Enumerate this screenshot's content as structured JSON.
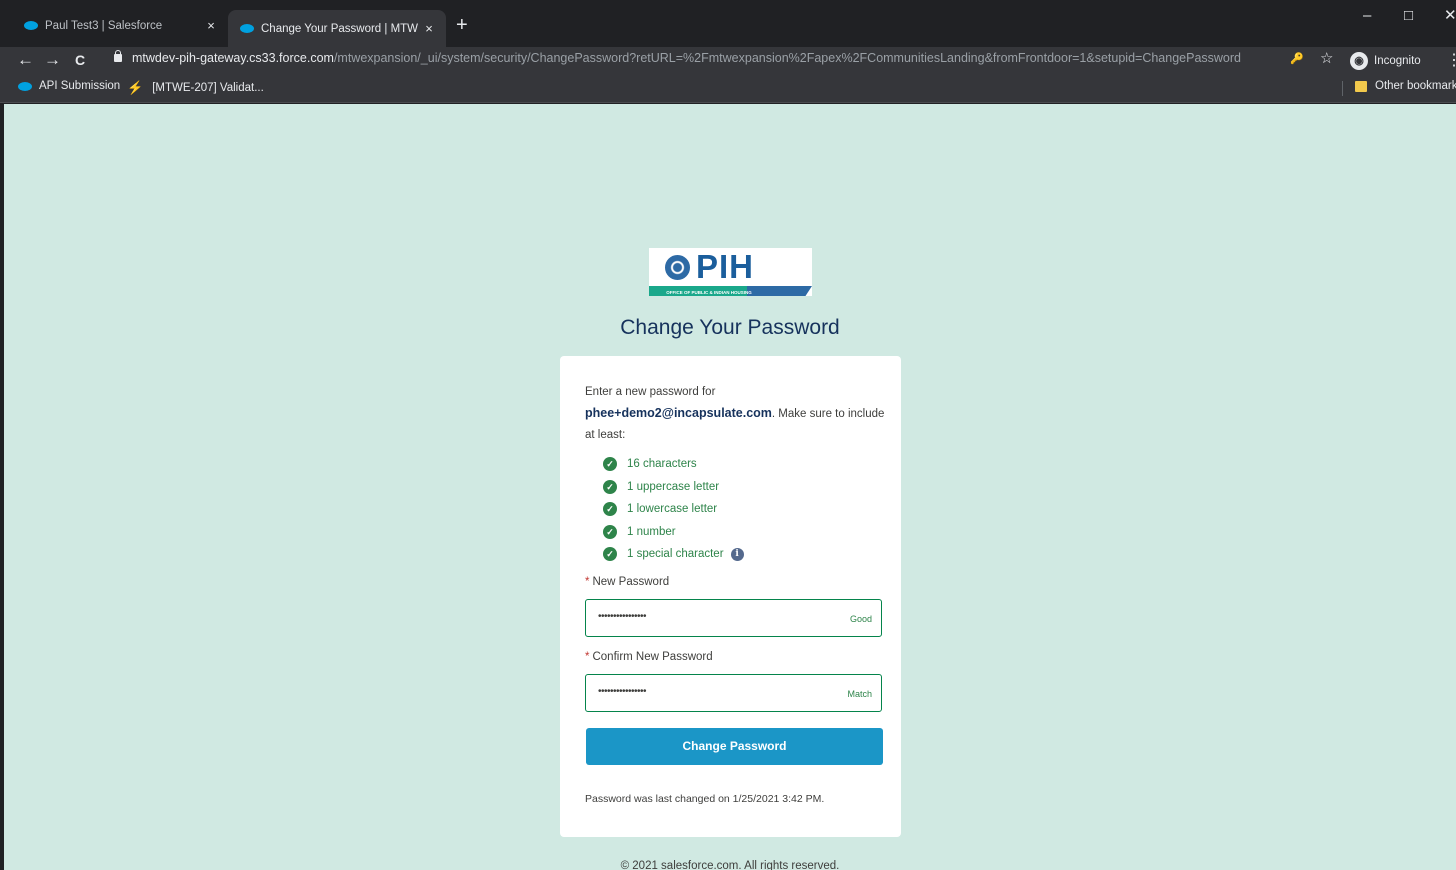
{
  "browser": {
    "tabs": [
      {
        "title": "Paul Test3 | Salesforce",
        "close": "×"
      },
      {
        "title": "Change Your Password | MTW Ex",
        "close": "×"
      }
    ],
    "new_tab": "+",
    "window_controls": {
      "minimize": "–",
      "maximize": "□",
      "close": "✕"
    },
    "nav": {
      "back": "←",
      "forward": "→",
      "reload": "C"
    },
    "url": {
      "host": "mtwdev-pih-gateway.cs33.force.com",
      "path": "/mtwexpansion/_ui/system/security/ChangePassword?retURL=%2Fmtwexpansion%2Fapex%2FCommunitiesLanding&fromFrontdoor=1&setupid=ChangePassword"
    },
    "key_glyph": "🔑",
    "star_glyph": "☆",
    "incognito_label": "Incognito",
    "menu_glyph": "⋮",
    "bookmarks": [
      {
        "label": "API Submission"
      },
      {
        "label": "[MTWE-207] Validat..."
      }
    ],
    "other_bookmarks": "Other bookmarks"
  },
  "page": {
    "logo": {
      "text": "PIH",
      "subtitle": "OFFICE OF PUBLIC & INDIAN HOUSING"
    },
    "title": "Change Your Password",
    "intro_prefix": "Enter a new password for",
    "email": "phee+demo2@incapsulate.com",
    "intro_suffix": ". Make sure to include at least:",
    "requirements": [
      {
        "label": "16 characters",
        "met": true
      },
      {
        "label": "1 uppercase letter",
        "met": true
      },
      {
        "label": "1 lowercase letter",
        "met": true
      },
      {
        "label": "1 number",
        "met": true
      },
      {
        "label": "1 special character",
        "met": true
      }
    ],
    "check_glyph": "✓",
    "info_glyph": "i",
    "required_marker": "*",
    "new_password": {
      "label": "New Password",
      "value": "••••••••••••••••",
      "strength": "Good"
    },
    "confirm_password": {
      "label": "Confirm New Password",
      "value": "••••••••••••••••",
      "status": "Match"
    },
    "submit_label": "Change Password",
    "last_changed": "Password was last changed on 1/25/2021 3:42 PM.",
    "footer": "© 2021 salesforce.com. All rights reserved."
  },
  "colors": {
    "page_bg": "#d0e9e2",
    "accent_button": "#1b96c7",
    "success_green": "#2e844a",
    "heading_navy": "#16325c",
    "required_red": "#c23934"
  }
}
